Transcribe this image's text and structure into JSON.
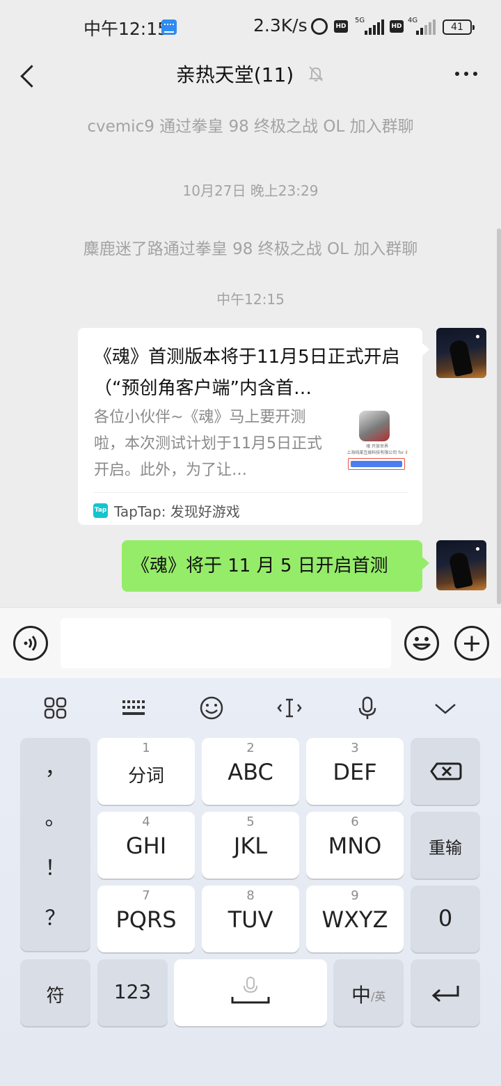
{
  "status_bar": {
    "time": "中午12:15",
    "net_speed": "2.3K/s",
    "sim1_network": "5G",
    "sim2_network": "4G",
    "hd_badge": "HD",
    "battery": "41"
  },
  "header": {
    "title": "亲热天堂(11)",
    "back_icon": "chevron-left-icon",
    "mute_icon": "bell-off-icon",
    "more_icon": "more-dots-icon"
  },
  "chat": {
    "system_message_1": "cvemic9 通过拳皇 98 终极之战 OL 加入群聊",
    "timestamp_1": "10月27日 晚上23:29",
    "system_message_2": "麋鹿迷了路通过拳皇 98 终极之战 OL 加入群聊",
    "timestamp_2": "中午12:15",
    "link_card": {
      "title": "《魂》首测版本将于11月5日正式开启（“预创角客户端”内含首…",
      "description": "各位小伙伴~《魂》马上要开测啦，本次测试计划于11月5日正式开启。此外，为了让…",
      "thumb_line_1": "魂 开放世界",
      "thumb_line_2": "上海纯莱互娱科技有限公司 for il",
      "thumb_button": "View in TapTap",
      "source_icon_text": "Tap",
      "source": "TapTap: 发现好游戏"
    },
    "text_message": "《魂》将于 11 月 5 日开启首测"
  },
  "input_bar": {
    "placeholder": "",
    "voice_icon": "voice-icon",
    "emoji_icon": "emoji-icon",
    "plus_icon": "plus-icon"
  },
  "keyboard": {
    "toolbar": [
      "grid-icon",
      "keyboard-icon",
      "emoji-icon",
      "cursor-icon",
      "microphone-icon",
      "collapse-icon"
    ],
    "punctuation": [
      "，",
      "。",
      "！",
      "？"
    ],
    "keys": [
      {
        "num": "1",
        "label": "分词"
      },
      {
        "num": "2",
        "label": "ABC"
      },
      {
        "num": "3",
        "label": "DEF"
      },
      {
        "num": "4",
        "label": "GHI"
      },
      {
        "num": "5",
        "label": "JKL"
      },
      {
        "num": "6",
        "label": "MNO"
      },
      {
        "num": "7",
        "label": "PQRS"
      },
      {
        "num": "8",
        "label": "TUV"
      },
      {
        "num": "9",
        "label": "WXYZ"
      }
    ],
    "delete_key": "backspace-icon",
    "reenter_key": "重输",
    "zero_key": "0",
    "symbol_key": "符",
    "num_key": "123",
    "space_key": "space-mic-icon",
    "lang_key_main": "中",
    "lang_key_alt": "/英",
    "enter_key": "enter-icon"
  }
}
